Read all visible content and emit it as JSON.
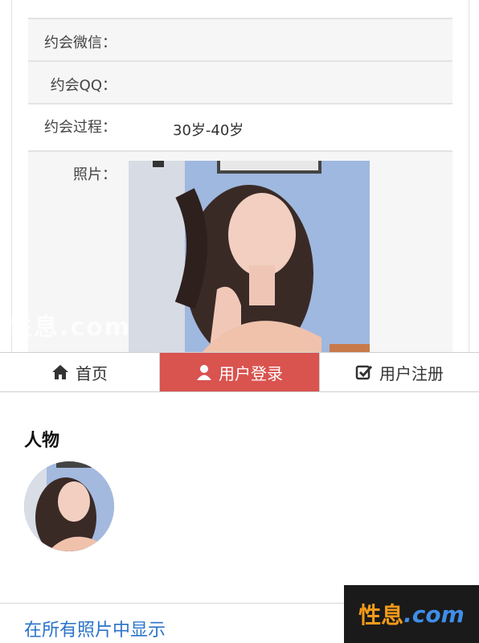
{
  "details": {
    "rows": [
      {
        "label": "约会微信：",
        "value": ""
      },
      {
        "label": "约会QQ：",
        "value": ""
      },
      {
        "label": "约会过程：",
        "value": "30岁-40岁"
      },
      {
        "label": "照片：",
        "value": ""
      }
    ]
  },
  "watermark_text": "性息.com",
  "tabs": [
    {
      "label": "首页",
      "icon": "home-icon"
    },
    {
      "label": "用户登录",
      "icon": "user-icon"
    },
    {
      "label": "用户注册",
      "icon": "check-square-icon"
    }
  ],
  "section": {
    "title": "人物"
  },
  "link": {
    "show_all": "在所有照片中显示"
  },
  "logo": {
    "cn": "性息",
    "en": ".com"
  },
  "colors": {
    "active_tab": "#d9534f",
    "link": "#2a73c9",
    "logo_bg": "#1a1a1a"
  }
}
